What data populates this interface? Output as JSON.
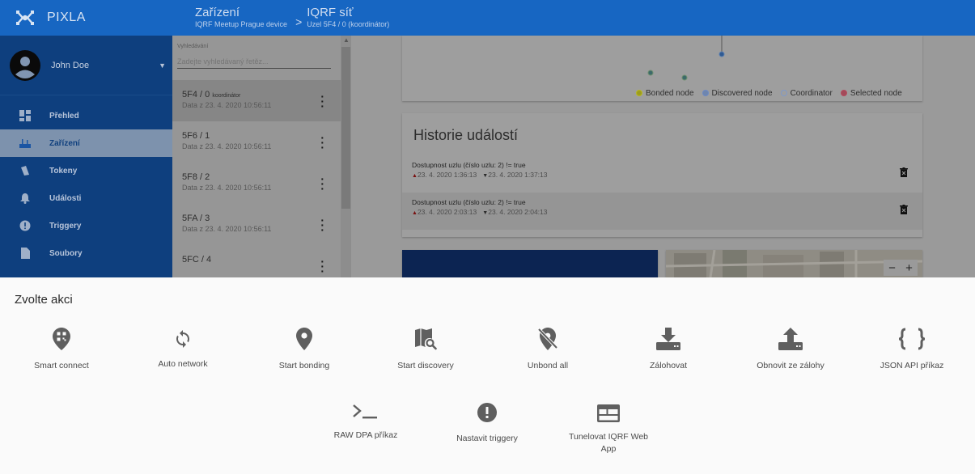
{
  "app": {
    "name": "PIXLA"
  },
  "breadcrumb": {
    "section_title": "Zařízení",
    "section_sub": "IQRF Meetup Prague device",
    "separator": ">",
    "page_title": "IQRF síť",
    "page_sub": "Uzel 5F4 / 0 (koordinátor)"
  },
  "user": {
    "name": "John Doe",
    "caret": "▼"
  },
  "sidebar": {
    "items": [
      {
        "label": "Přehled",
        "icon": "dashboard-icon"
      },
      {
        "label": "Zařízení",
        "icon": "router-icon",
        "active": true
      },
      {
        "label": "Tokeny",
        "icon": "tokens-icon"
      },
      {
        "label": "Události",
        "icon": "bell-icon"
      },
      {
        "label": "Triggery",
        "icon": "alert-icon"
      },
      {
        "label": "Soubory",
        "icon": "file-icon"
      }
    ]
  },
  "search": {
    "label": "Vyhledávání",
    "placeholder": "Zadejte vyhledávaný řetěz..."
  },
  "devices": [
    {
      "id": "5F4 / 0",
      "tag": "koordinátor",
      "date": "Data z 23. 4. 2020 10:56:11"
    },
    {
      "id": "5F6 / 1",
      "tag": "",
      "date": "Data z 23. 4. 2020 10:56:11"
    },
    {
      "id": "5F8 / 2",
      "tag": "",
      "date": "Data z 23. 4. 2020 10:56:11"
    },
    {
      "id": "5FA / 3",
      "tag": "",
      "date": "Data z 23. 4. 2020 10:56:11"
    },
    {
      "id": "5FC / 4",
      "tag": "",
      "date": ""
    }
  ],
  "legend": [
    "Bonded node",
    "Discovered node",
    "Coordinator",
    "Selected node"
  ],
  "legend_colors": [
    "#b8b81e",
    "#6b88c4",
    "#7f99c8",
    "#b4495d"
  ],
  "history": {
    "title": "Historie událostí",
    "events": [
      {
        "text": "Dostupnost uzlu (číslo uzlu: 2) != true",
        "up": "23. 4. 2020 1:36:13",
        "down": "23. 4. 2020 1:37:13"
      },
      {
        "text": "Dostupnost uzlu (číslo uzlu: 2) != true",
        "up": "23. 4. 2020 2:03:13",
        "down": "23. 4. 2020 2:04:13"
      }
    ]
  },
  "sheet": {
    "title": "Zvolte akci",
    "actions": [
      {
        "label": "Smart connect",
        "icon": "qr-pin-icon"
      },
      {
        "label": "Auto network",
        "icon": "sync-icon"
      },
      {
        "label": "Start bonding",
        "icon": "pin-icon"
      },
      {
        "label": "Start discovery",
        "icon": "map-search-icon"
      },
      {
        "label": "Unbond all",
        "icon": "pin-off-icon"
      },
      {
        "label": "Zálohovat",
        "icon": "download-icon"
      },
      {
        "label": "Obnovit ze zálohy",
        "icon": "upload-icon"
      },
      {
        "label": "JSON API příkaz",
        "icon": "json-braces-icon"
      },
      {
        "label": "RAW DPA příkaz",
        "icon": "terminal-icon"
      },
      {
        "label": "Nastavit triggery",
        "icon": "alert-circle-icon"
      },
      {
        "label": "Tunelovat IQRF Web App",
        "icon": "web-app-icon"
      }
    ]
  },
  "colors": {
    "topbar": "#1766c2",
    "sheet_bg": "#fafafa",
    "icon": "#5f5f5f"
  }
}
